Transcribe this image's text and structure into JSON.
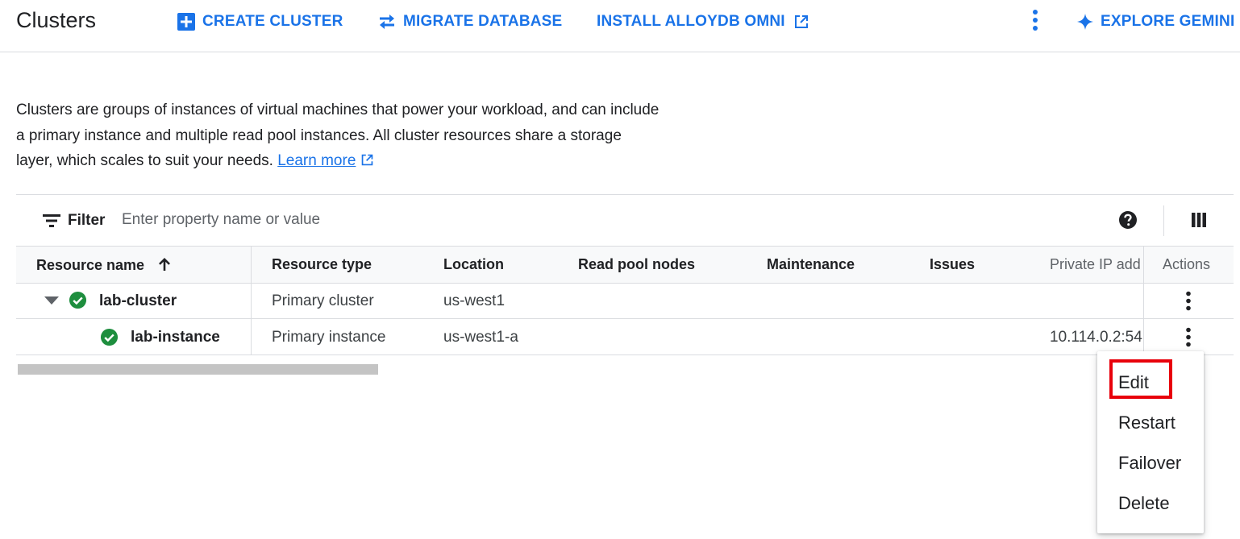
{
  "header": {
    "title": "Clusters",
    "create_label": "CREATE CLUSTER",
    "migrate_label": "MIGRATE DATABASE",
    "install_label": "INSTALL ALLOYDB OMNI",
    "gemini_label": "EXPLORE GEMINI"
  },
  "description": {
    "text": "Clusters are groups of instances of virtual machines that power your workload, and can include a primary instance and multiple read pool instances. All cluster resources share a storage layer, which scales to suit your needs.",
    "link": "Learn more"
  },
  "filter": {
    "label": "Filter",
    "placeholder": "Enter property name or value"
  },
  "table": {
    "columns": {
      "resource_name": "Resource name",
      "resource_type": "Resource type",
      "location": "Location",
      "read_pool_nodes": "Read pool nodes",
      "maintenance": "Maintenance",
      "issues": "Issues",
      "private_ip": "Private IP add",
      "actions": "Actions"
    },
    "rows": [
      {
        "name": "lab-cluster",
        "type": "Primary cluster",
        "location": "us-west1",
        "read_pool_nodes": "",
        "maintenance": "",
        "issues": "",
        "private_ip": ""
      },
      {
        "name": "lab-instance",
        "type": "Primary instance",
        "location": "us-west1-a",
        "read_pool_nodes": "",
        "maintenance": "",
        "issues": "",
        "private_ip": "10.114.0.2:54"
      }
    ]
  },
  "menu": {
    "items": [
      "Edit",
      "Restart",
      "Failover",
      "Delete"
    ],
    "highlighted": "Edit"
  },
  "colors": {
    "accent": "#1a73e8",
    "status_ok": "#1e8e3e",
    "highlight": "#e8000b"
  },
  "icons": [
    "add-box-icon",
    "swap-arrows-icon",
    "external-link-icon",
    "more-vert-icon",
    "sparkle-icon",
    "filter-icon",
    "help-icon",
    "columns-icon",
    "sort-up-arrow-icon",
    "expand-caret-icon",
    "check-circle-icon"
  ]
}
